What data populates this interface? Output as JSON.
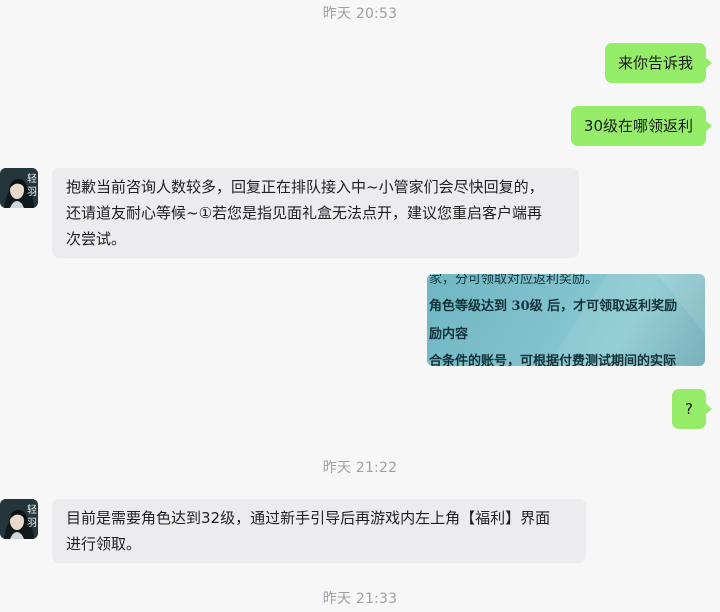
{
  "timestamps": [
    "昨天 20:53",
    "昨天 21:22",
    "昨天 21:33"
  ],
  "messages": {
    "out1": "来你告诉我",
    "out2": "30级在哪领返利",
    "in1_lines": [
      "抱歉当前咨询人数较多，回复正在排队接入中~小管家们会尽快回复的，",
      "还请道友耐心等候~①若您是指见面礼盒无法点开，建议您重启客户端再",
      "次尝试。"
    ],
    "image_lines": [
      "家，分可领取对应返利奖励。",
      "角色等级达到 30级 后，才可领取返利奖励",
      "励内容",
      "合条件的账号，可根据付费测试期间的实际"
    ],
    "out3": "?",
    "in2_lines": [
      "目前是需要角色达到32级，通过新手引导后再游戏内左上角【福利】界面",
      "进行领取。"
    ]
  },
  "avatar": {
    "caption": "轻羽"
  },
  "colors": {
    "outgoing": "#95ec69",
    "incoming": "#ececef",
    "timestamp": "#a0a0a6"
  }
}
